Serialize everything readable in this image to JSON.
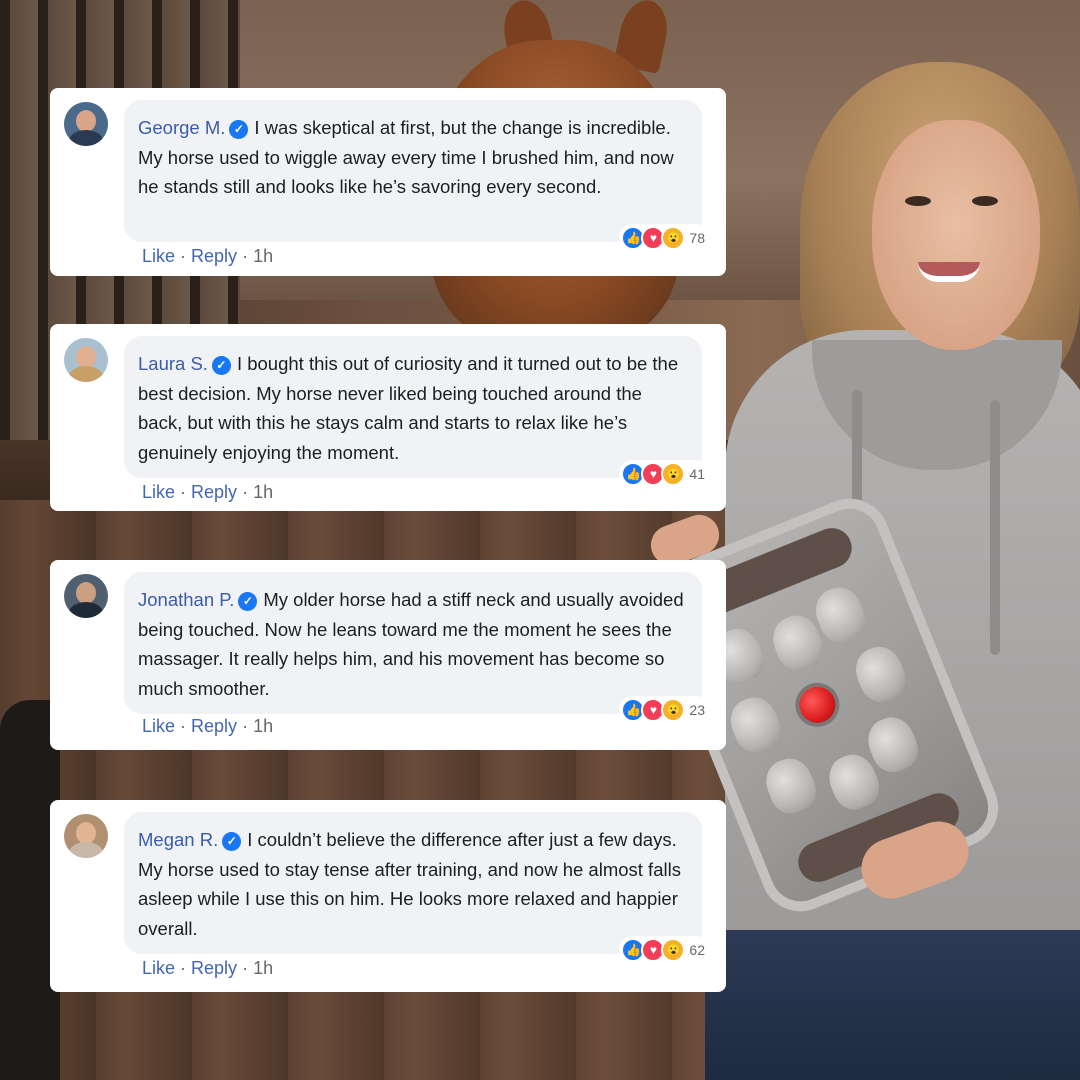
{
  "comments": [
    {
      "name": "George M.",
      "text": "I was skeptical at first, but the change is incredible. My horse used to wiggle away every time I brushed him, and now he stands still and looks like he’s savoring every second.",
      "reaction_count": "78",
      "like": "Like",
      "reply": "Reply",
      "time": "1h"
    },
    {
      "name": "Laura S.",
      "text": "I bought this out of curiosity and it turned out to be the best decision. My horse never liked being touched around the back, but with this he stays calm and starts to relax like he’s genuinely enjoying the moment.",
      "reaction_count": "41",
      "like": "Like",
      "reply": "Reply",
      "time": "1h"
    },
    {
      "name": "Jonathan P.",
      "text": "My older horse had a stiff neck and usually avoided being touched. Now he leans toward me the moment he sees the massager. It really helps him, and his movement has become so much smoother.",
      "reaction_count": "23",
      "like": "Like",
      "reply": "Reply",
      "time": "1h"
    },
    {
      "name": "Megan R.",
      "text": "I couldn’t believe the difference after just a few days. My horse used to stay tense after training, and now he almost falls asleep while I use this on him. He looks more relaxed and happier overall.",
      "reaction_count": "62",
      "like": "Like",
      "reply": "Reply",
      "time": "1h"
    }
  ],
  "reaction_icons": [
    "like-icon",
    "love-icon",
    "wow-icon"
  ],
  "colors": {
    "name": "#3b5da7",
    "bubble": "#f0f2f5",
    "like_blue": "#1877f2",
    "love_red": "#f33e58",
    "wow_yellow": "#f7b125"
  },
  "separator": "·"
}
